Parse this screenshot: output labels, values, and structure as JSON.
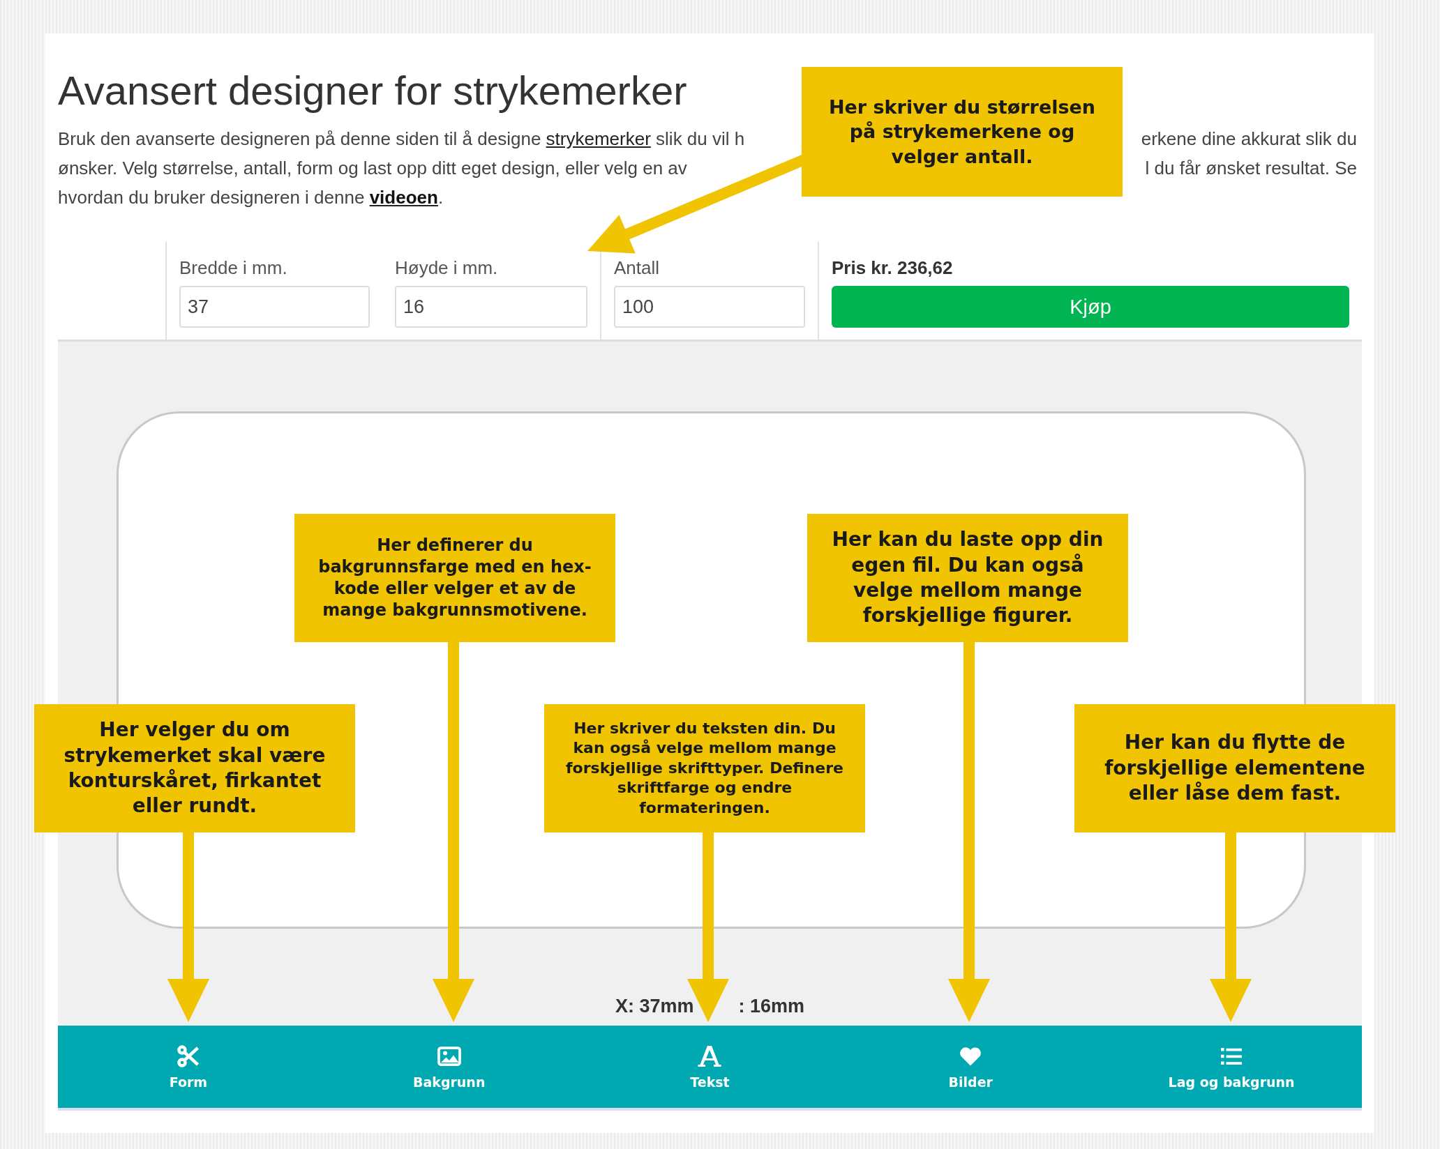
{
  "title": "Avansert designer for strykemerker",
  "intro_lines": [
    {
      "left": [
        {
          "kind": "text",
          "text": "Bruk den avanserte designeren på denne siden til å designe "
        },
        {
          "kind": "link",
          "text": "strykemerker"
        },
        {
          "kind": "text",
          "text": " slik du vil h"
        }
      ],
      "right": "erkene dine akkurat slik du"
    },
    {
      "left": [
        {
          "kind": "text",
          "text": "ønsker. Velg størrelse, antall, form og last opp ditt eget design, eller velg en av"
        }
      ],
      "right": "l du får ønsket resultat. Se"
    },
    {
      "left": [
        {
          "kind": "text",
          "text": "hvordan du bruker designeren i denne "
        },
        {
          "kind": "bold_link",
          "text": "videoen"
        },
        {
          "kind": "text",
          "text": "."
        }
      ]
    }
  ],
  "fields": [
    {
      "label": "Bredde i mm.",
      "value": "37"
    },
    {
      "label": "Høyde i mm.",
      "value": "16"
    },
    {
      "label": "Antall",
      "value": "100"
    }
  ],
  "price": "Pris kr. 236,62",
  "buy_button": "Kjøp",
  "dimensions": {
    "left": "X: 37mm",
    "right": ": 16mm"
  },
  "toolbar": [
    {
      "label": "Form"
    },
    {
      "label": "Bakgrunn"
    },
    {
      "label": "Tekst"
    },
    {
      "label": "Bilder"
    },
    {
      "label": "Lag og bakgrunn"
    }
  ],
  "callouts": [
    {
      "text": "Her skriver du størrelsen på strykemerkene og velger antall."
    },
    {
      "text": "Her definerer du bakgrunnsfarge med en hex-kode eller velger et av de mange bakgrunnsmotivene."
    },
    {
      "text": "Her kan du laste opp din egen fil. Du kan også velge mellom mange forskjellige figurer."
    },
    {
      "text": "Her velger du om strykemerket skal være konturskåret, firkantet eller rundt."
    },
    {
      "text": "Her skriver du teksten din. Du kan også velge mellom mange forskjellige skrifttyper. Definere skriftfarge og endre formateringen."
    },
    {
      "text": "Her kan du flytte de forskjellige elementene eller låse dem fast."
    }
  ]
}
